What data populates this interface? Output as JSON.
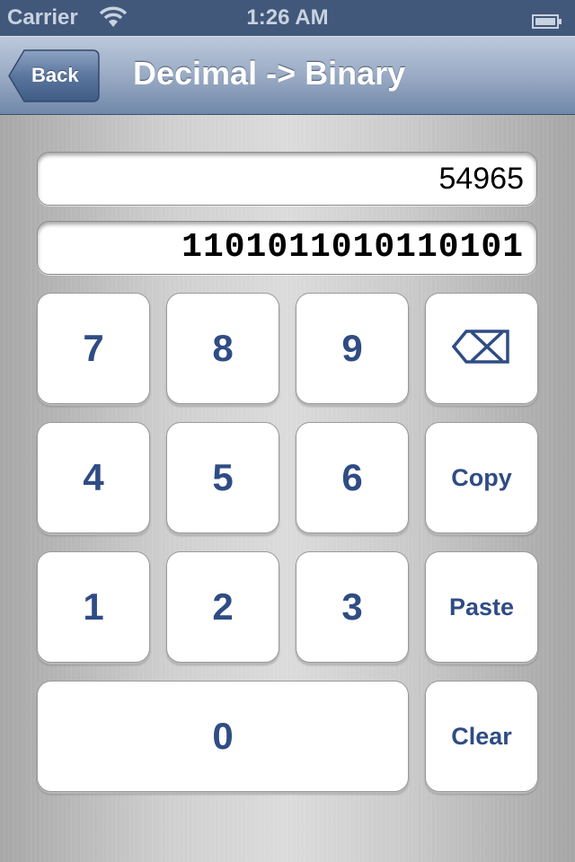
{
  "status_bar": {
    "carrier": "Carrier",
    "wifi_icon": "wifi-icon",
    "time": "1:26 AM",
    "battery_icon": "battery-icon",
    "battery_level": 1.0
  },
  "nav_bar": {
    "back_label": "Back",
    "title": "Decimal -> Binary"
  },
  "fields": {
    "decimal_value": "54965",
    "binary_value": "1101011010110101"
  },
  "keypad": {
    "keys": [
      {
        "label": "7"
      },
      {
        "label": "8"
      },
      {
        "label": "9"
      },
      {
        "label": "",
        "icon": "backspace-icon"
      },
      {
        "label": "4"
      },
      {
        "label": "5"
      },
      {
        "label": "6"
      },
      {
        "label": "Copy"
      },
      {
        "label": "1"
      },
      {
        "label": "2"
      },
      {
        "label": "3"
      },
      {
        "label": "Paste"
      },
      {
        "label": "0"
      },
      {
        "label": "Clear"
      }
    ]
  },
  "colors": {
    "key_text": "#2f4c84",
    "status_bar_bg": "#42587a",
    "nav_bar_bg": "#7088aa"
  }
}
